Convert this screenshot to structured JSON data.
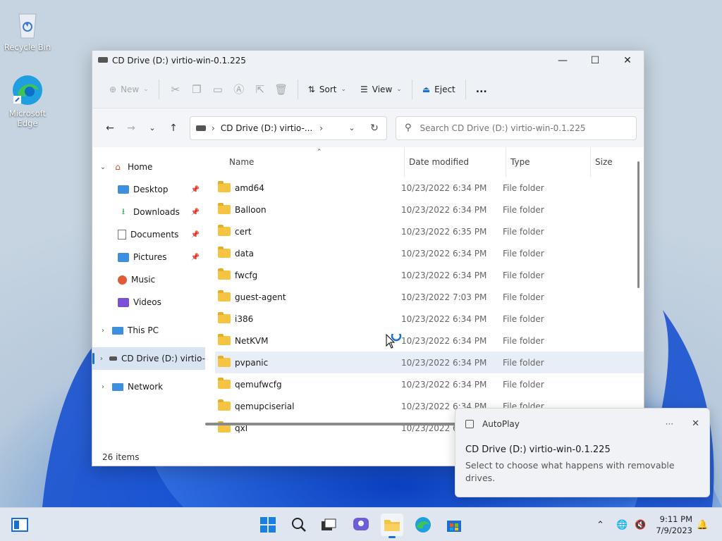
{
  "desktop": {
    "icons": [
      {
        "label": "Recycle Bin",
        "icon": "recycle-bin-icon"
      },
      {
        "label": "Microsoft Edge",
        "icon": "edge-icon"
      }
    ]
  },
  "window": {
    "title": "CD Drive (D:) virtio-win-0.1.225",
    "controls": {
      "minimize": "—",
      "maximize": "☐",
      "close": "✕"
    }
  },
  "toolbar": {
    "new_label": "New",
    "sort_label": "Sort",
    "view_label": "View",
    "eject_label": "Eject",
    "more_label": "..."
  },
  "navigation": {
    "address_text": "CD Drive (D:) virtio-...",
    "search_placeholder": "Search CD Drive (D:) virtio-win-0.1.225"
  },
  "sidebar": {
    "home": "Home",
    "quick_access": [
      {
        "label": "Desktop",
        "icon": "desktop-icon",
        "pinned": true
      },
      {
        "label": "Downloads",
        "icon": "downloads-icon",
        "pinned": true
      },
      {
        "label": "Documents",
        "icon": "documents-icon",
        "pinned": true
      },
      {
        "label": "Pictures",
        "icon": "pictures-icon",
        "pinned": true
      },
      {
        "label": "Music",
        "icon": "music-icon",
        "pinned": false
      },
      {
        "label": "Videos",
        "icon": "videos-icon",
        "pinned": false
      }
    ],
    "this_pc": "This PC",
    "cd_drive": "CD Drive (D:) virtio-",
    "network": "Network"
  },
  "file_list": {
    "columns": [
      "Name",
      "Date modified",
      "Type",
      "Size"
    ],
    "rows": [
      {
        "name": "amd64",
        "date": "10/23/2022 6:34 PM",
        "type": "File folder"
      },
      {
        "name": "Balloon",
        "date": "10/23/2022 6:34 PM",
        "type": "File folder"
      },
      {
        "name": "cert",
        "date": "10/23/2022 6:35 PM",
        "type": "File folder"
      },
      {
        "name": "data",
        "date": "10/23/2022 6:34 PM",
        "type": "File folder"
      },
      {
        "name": "fwcfg",
        "date": "10/23/2022 6:34 PM",
        "type": "File folder"
      },
      {
        "name": "guest-agent",
        "date": "10/23/2022 7:03 PM",
        "type": "File folder"
      },
      {
        "name": "i386",
        "date": "10/23/2022 6:34 PM",
        "type": "File folder"
      },
      {
        "name": "NetKVM",
        "date": "10/23/2022 6:34 PM",
        "type": "File folder"
      },
      {
        "name": "pvpanic",
        "date": "10/23/2022 6:34 PM",
        "type": "File folder",
        "selected": true
      },
      {
        "name": "qemufwcfg",
        "date": "10/23/2022 6:34 PM",
        "type": "File folder"
      },
      {
        "name": "qemupciserial",
        "date": "10/23/2022 6:34 PM",
        "type": "File folder"
      },
      {
        "name": "qxl",
        "date": "10/23/2022 6:3",
        "type": ""
      }
    ]
  },
  "status": {
    "item_count": "26 items"
  },
  "autoplay": {
    "header": "AutoPlay",
    "more": "···",
    "close": "✕",
    "title": "CD Drive (D:) virtio-win-0.1.225",
    "message": "Select to choose what happens with removable drives."
  },
  "taskbar": {
    "time": "9:11 PM",
    "date": "7/9/2023"
  },
  "colors": {
    "accent": "#1a6fd4",
    "folder": "#f5c443"
  }
}
